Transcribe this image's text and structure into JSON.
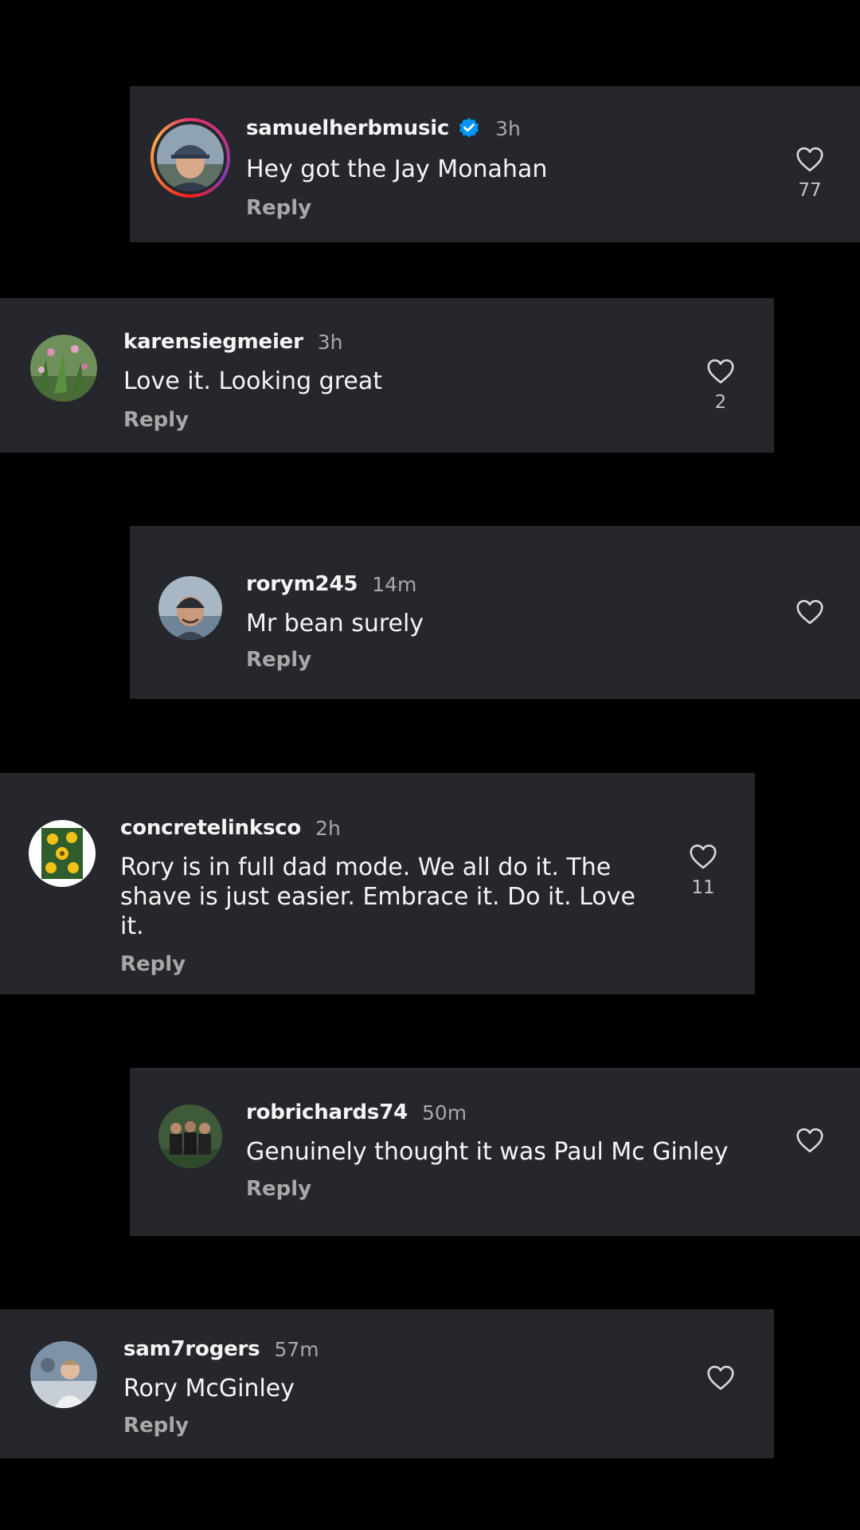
{
  "comments": [
    {
      "username": "samuelherbmusic",
      "verified": true,
      "time": "3h",
      "text": "Hey got the Jay Monahan",
      "reply_label": "Reply",
      "likes": "77",
      "avatar_icon": "person-cap-photo"
    },
    {
      "username": "karensiegmeier",
      "verified": false,
      "time": "3h",
      "text": "Love it. Looking great",
      "reply_label": "Reply",
      "likes": "2",
      "avatar_icon": "garden-photo"
    },
    {
      "username": "rorym245",
      "verified": false,
      "time": "14m",
      "text": "Mr bean surely",
      "reply_label": "Reply",
      "likes": "",
      "avatar_icon": "person-beanie-photo"
    },
    {
      "username": "concretelinksco",
      "verified": false,
      "time": "2h",
      "text": "Rory is in full dad mode. We all do it. The shave is just easier. Embrace it. Do it. Love it.",
      "reply_label": "Reply",
      "likes": "11",
      "avatar_icon": "sunflower-logo"
    },
    {
      "username": "robrichards74",
      "verified": false,
      "time": "50m",
      "text": "Genuinely thought it was Paul Mc Ginley",
      "reply_label": "Reply",
      "likes": "",
      "avatar_icon": "group-photo"
    },
    {
      "username": "sam7rogers",
      "verified": false,
      "time": "57m",
      "text": "Rory McGinley",
      "reply_label": "Reply",
      "likes": "",
      "avatar_icon": "child-photo"
    }
  ],
  "colors": {
    "background": "#000000",
    "card": "#25272c",
    "text": "#f5f5f5",
    "muted": "#a8a8a8",
    "verified": "#0095f6"
  }
}
